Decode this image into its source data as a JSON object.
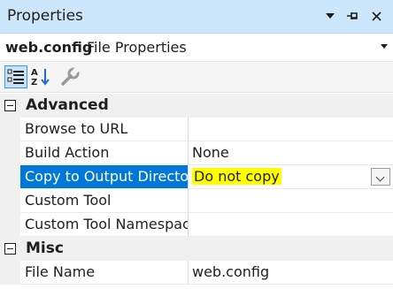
{
  "window": {
    "title": "Properties",
    "dropdown_icon": "chevron-down-icon",
    "pin_icon": "pin-icon",
    "close_icon": "close-icon"
  },
  "object_selector": {
    "name": "web.config",
    "type": "File Properties"
  },
  "toolbar": {
    "buttons": [
      "categorized-icon",
      "alphabetical-icon",
      "property-pages-icon"
    ]
  },
  "grid": {
    "categories": [
      {
        "label": "Advanced",
        "properties": [
          {
            "name": "Browse to URL",
            "value": ""
          },
          {
            "name": "Build Action",
            "value": "None"
          },
          {
            "name": "Copy to Output Directo",
            "value": "Do not copy"
          },
          {
            "name": "Custom Tool",
            "value": ""
          },
          {
            "name": "Custom Tool Namespac",
            "value": ""
          }
        ]
      },
      {
        "label": "Misc",
        "properties": [
          {
            "name": "File Name",
            "value": "web.config"
          }
        ]
      }
    ]
  },
  "colors": {
    "titlebar": "#cce6fb",
    "selection": "#0078d7",
    "highlight": "#ffff00"
  }
}
